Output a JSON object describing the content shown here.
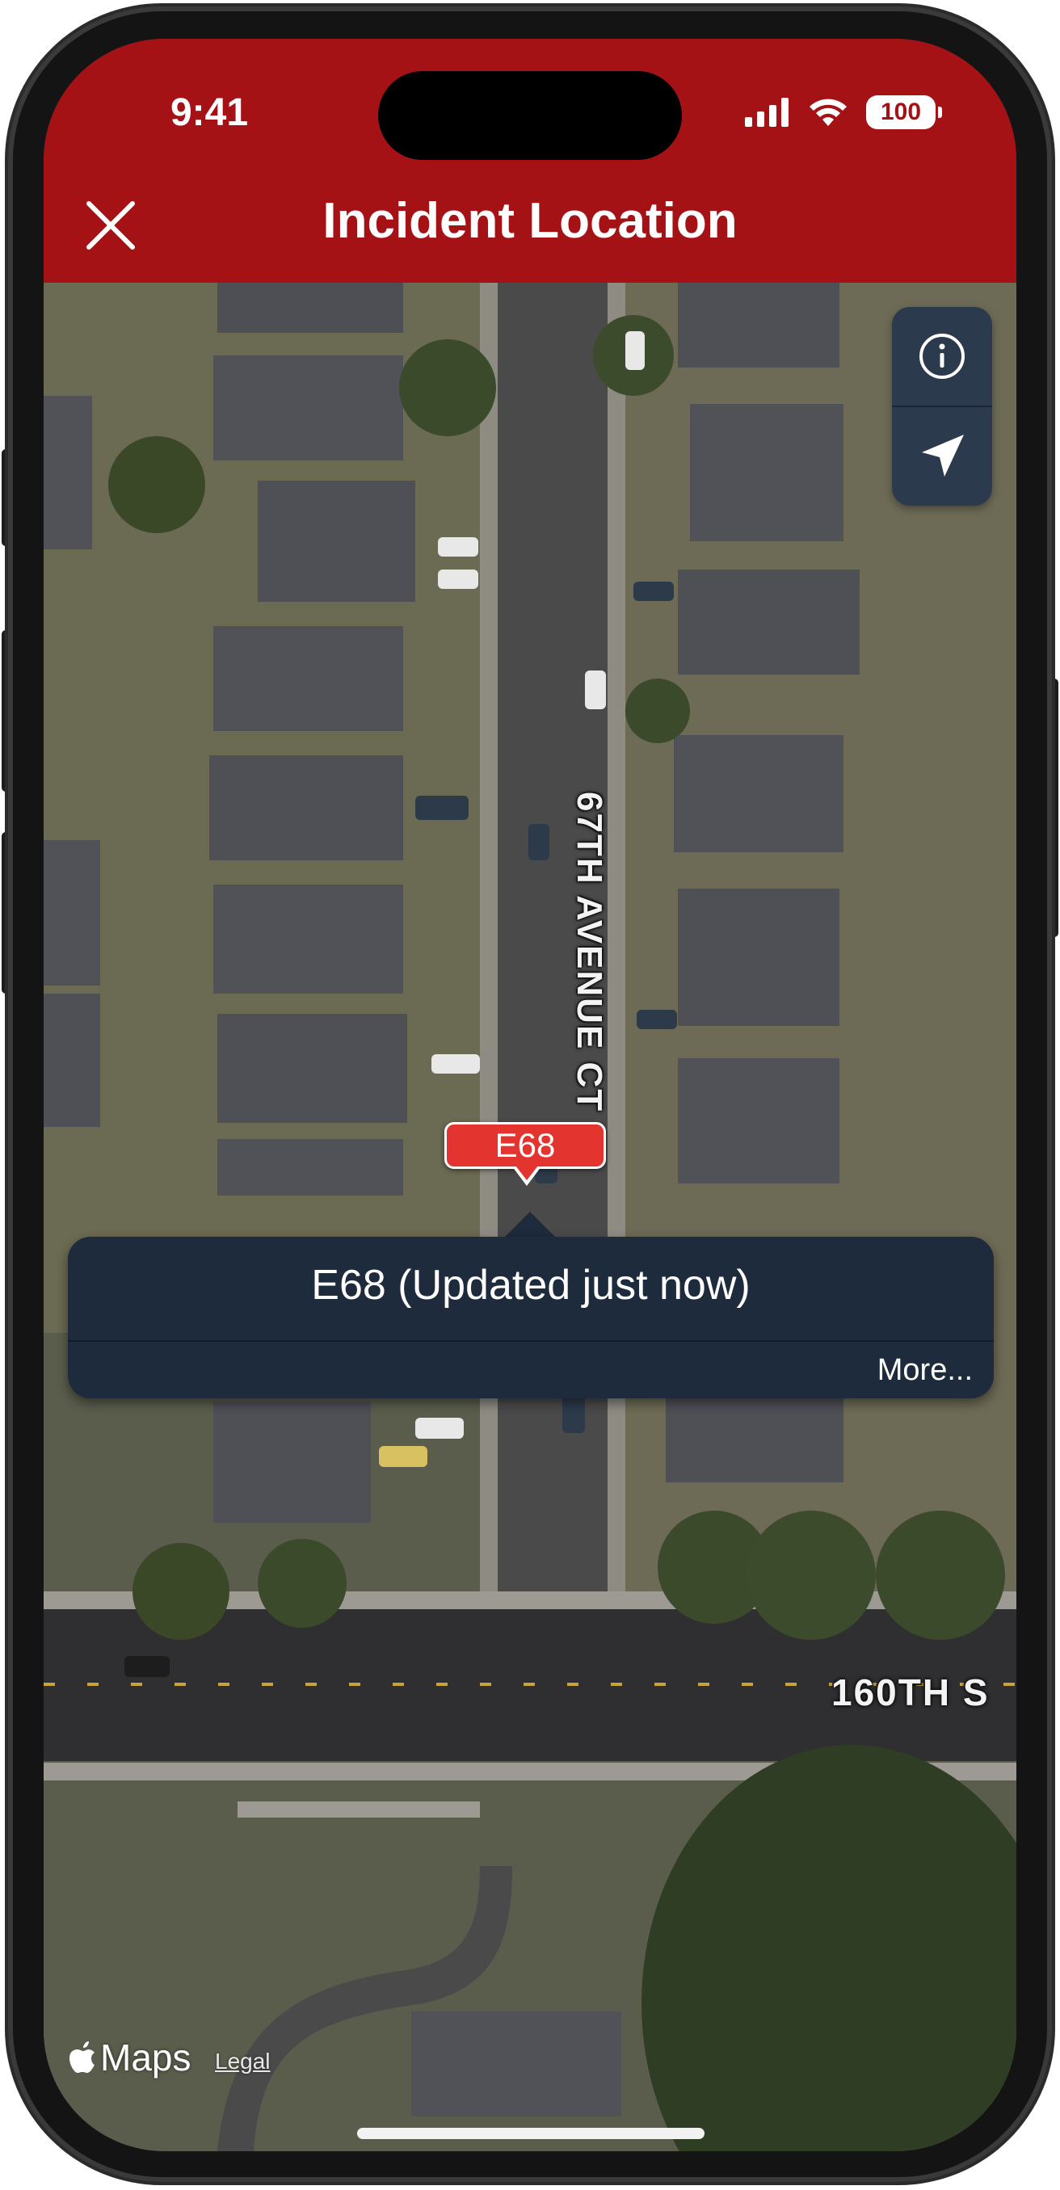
{
  "status_bar": {
    "time": "9:41",
    "battery": "100"
  },
  "nav": {
    "title": "Incident Location",
    "close_icon": "close-icon"
  },
  "map": {
    "street_vertical": "67TH AVENUE CT E",
    "street_horizontal": "160TH S",
    "controls": [
      "info-icon",
      "location-arrow-icon"
    ]
  },
  "unit_pin": {
    "label": "E68"
  },
  "callout": {
    "title": "E68 (Updated just now)",
    "more_label": "More..."
  },
  "attribution": {
    "maps_label": "Maps",
    "legal_label": "Legal"
  },
  "colors": {
    "header_red": "#a51216",
    "callout_navy": "#1d2b3c",
    "pin_red": "#e3342f"
  }
}
